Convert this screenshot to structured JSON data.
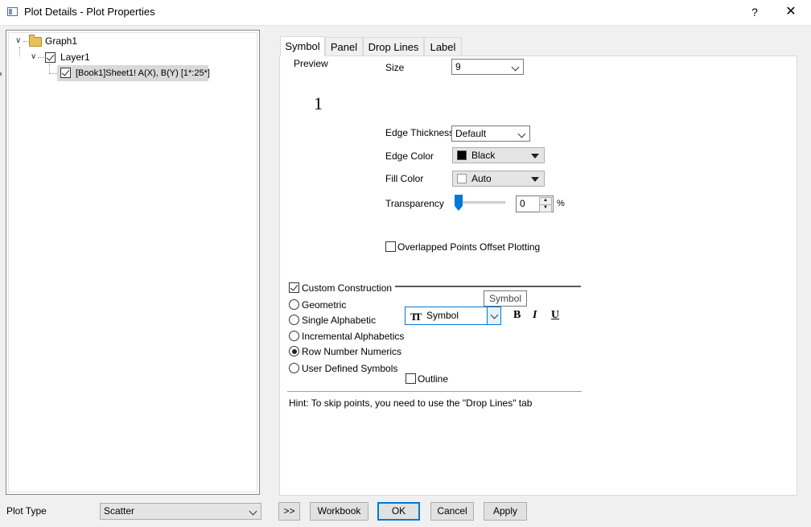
{
  "window": {
    "title": "Plot Details - Plot Properties",
    "help_label": "?",
    "close_label": "✕"
  },
  "tree": {
    "graph_label": "Graph1",
    "layer_label": "Layer1",
    "plot_label": "[Book1]Sheet1! A(X), B(Y) [1*:25*]"
  },
  "tabs": [
    {
      "label": "Symbol",
      "active": true
    },
    {
      "label": "Panel"
    },
    {
      "label": "Drop Lines"
    },
    {
      "label": "Label"
    }
  ],
  "symbol": {
    "preview_label": "Preview",
    "preview_glyph": "1",
    "size_label": "Size",
    "size_value": "9",
    "edge_thickness_label": "Edge Thickness",
    "edge_thickness_value": "Default",
    "edge_color_label": "Edge Color",
    "edge_color_value": "Black",
    "edge_color_hex": "#000000",
    "fill_color_label": "Fill Color",
    "fill_color_value": "Auto",
    "fill_color_hex": "#ffffff",
    "transparency_label": "Transparency",
    "transparency_value": "0",
    "transparency_unit": "%",
    "overlapped_label": "Overlapped Points Offset Plotting",
    "overlapped_checked": false
  },
  "construction": {
    "custom_label": "Custom Construction",
    "custom_checked": true,
    "options": [
      {
        "label": "Geometric",
        "selected": false
      },
      {
        "label": "Single Alphabetic",
        "selected": false
      },
      {
        "label": "Incremental Alphabetics",
        "selected": false
      },
      {
        "label": "Row Number Numerics",
        "selected": true
      },
      {
        "label": "User Defined Symbols",
        "selected": false
      }
    ],
    "font_value": "Symbol",
    "font_icon": "TT-icon",
    "bold_label": "B",
    "italic_label": "I",
    "underline_label": "U",
    "tooltip": "Symbol",
    "outline_label": "Outline",
    "outline_checked": false
  },
  "hint": "Hint: To skip points, you need to use the \"Drop Lines\" tab",
  "bottom": {
    "plot_type_label": "Plot Type",
    "plot_type_value": "Scatter",
    "expand_label": ">>",
    "workbook_label": "Workbook",
    "ok_label": "OK",
    "cancel_label": "Cancel",
    "apply_label": "Apply"
  }
}
